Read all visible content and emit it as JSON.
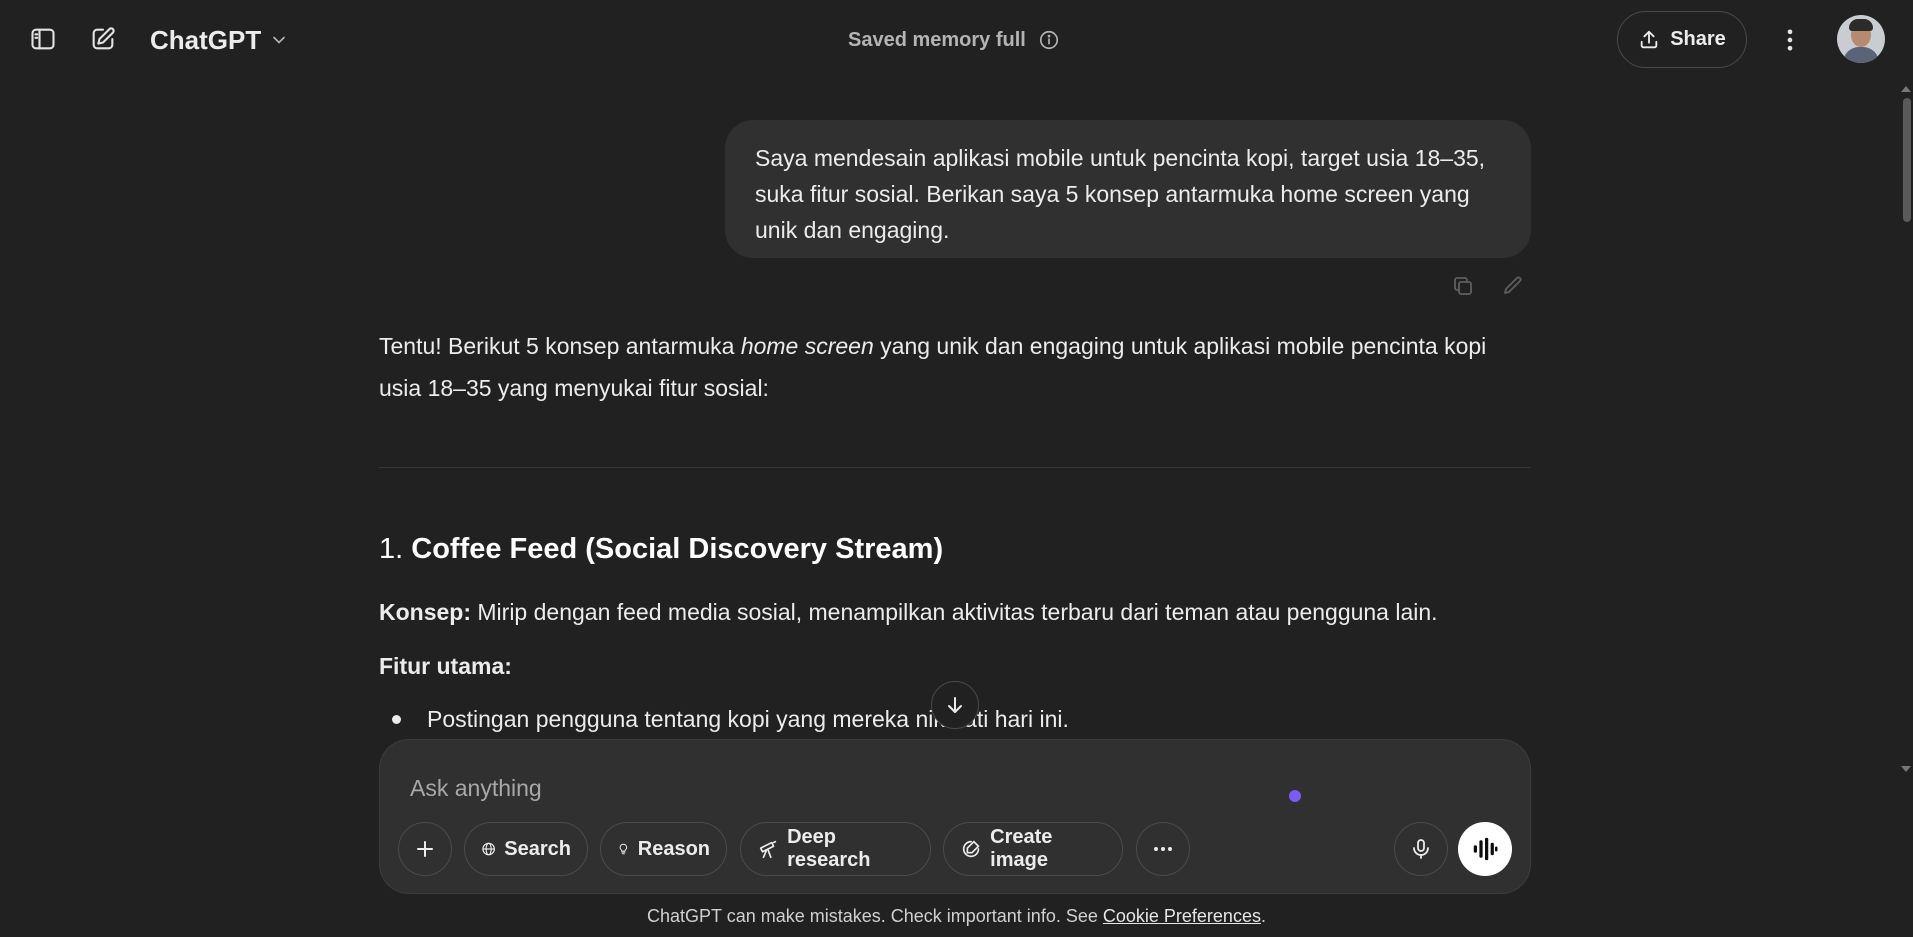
{
  "header": {
    "model_label": "ChatGPT",
    "memory_status": "Saved memory full",
    "share_label": "Share"
  },
  "icons": {
    "sidebar": "sidebar-toggle-icon",
    "new_chat": "new-chat-pencil-icon",
    "chevron": "chevron-down-icon",
    "info": "info-icon",
    "share": "upload-share-icon",
    "more": "vertical-dots-icon",
    "copy": "copy-icon",
    "edit": "pencil-icon",
    "arrow_down": "arrow-down-icon",
    "plus": "plus-icon",
    "globe": "globe-icon",
    "bulb": "lightbulb-icon",
    "telescope": "telescope-icon",
    "image": "create-image-icon",
    "dots": "horizontal-dots-icon",
    "mic": "microphone-icon",
    "voice": "voice-waveform-icon"
  },
  "user_message": {
    "text": "Saya mendesain aplikasi mobile untuk pencinta kopi, target usia 18–35, suka fitur sosial. Berikan saya 5 konsep antarmuka home screen yang unik dan engaging."
  },
  "assistant_message": {
    "intro_before": "Tentu! Berikut 5 konsep antarmuka ",
    "intro_emphasis": "home screen",
    "intro_after": " yang unik dan engaging untuk aplikasi mobile pencinta kopi usia 18–35 yang menyukai fitur sosial:",
    "section_number": "1.",
    "section_title": "Coffee Feed (Social Discovery Stream)",
    "concept_label": "Konsep:",
    "concept_text": " Mirip dengan feed media sosial, menampilkan aktivitas terbaru dari teman atau pengguna lain.",
    "features_label": "Fitur utama:",
    "bullet_1": "Postingan pengguna tentang kopi yang mereka nikmati hari ini."
  },
  "composer": {
    "placeholder": "Ask anything",
    "search_label": "Search",
    "reason_label": "Reason",
    "deep_research_label": "Deep research",
    "create_image_label": "Create image"
  },
  "footer": {
    "disclaimer_text": "ChatGPT can make mistakes. Check important info. See ",
    "cookie_link": "Cookie Preferences",
    "disclaimer_end": "."
  },
  "colors": {
    "background": "#212121",
    "bubble": "#303030",
    "text": "#ececec",
    "accent_cursor": "#7a5af8"
  }
}
